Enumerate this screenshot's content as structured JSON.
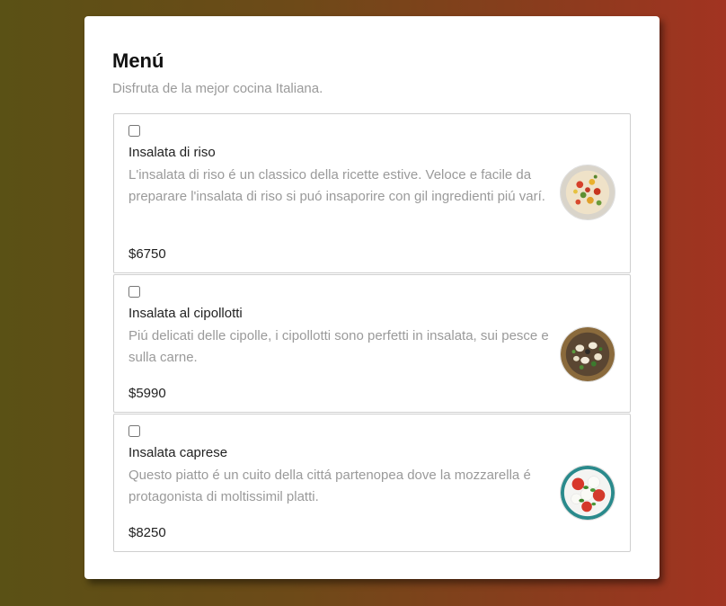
{
  "menu": {
    "title": "Menú",
    "subtitle": "Disfruta de la mejor cocina Italiana.",
    "items": [
      {
        "name": "Insalata di riso",
        "description": "L'insalata di riso é un classico della ricette estive. Veloce e facile da preparare l'insalata di riso si puó insaporire con gil ingredienti piú varí.",
        "price": "$6750",
        "checked": false,
        "image_icon": "rice-salad-image"
      },
      {
        "name": "Insalata al cipollotti",
        "description": "Piú delicati delle cipolle, i cipollotti sono perfetti in insalata, sui pesce e sulla carne.",
        "price": "$5990",
        "checked": false,
        "image_icon": "onion-salad-image"
      },
      {
        "name": "Insalata caprese",
        "description": "Questo piatto é un cuito della cittá partenopea dove la mozzarella é protagonista di moltissimil platti.",
        "price": "$8250",
        "checked": false,
        "image_icon": "caprese-salad-image"
      }
    ]
  }
}
